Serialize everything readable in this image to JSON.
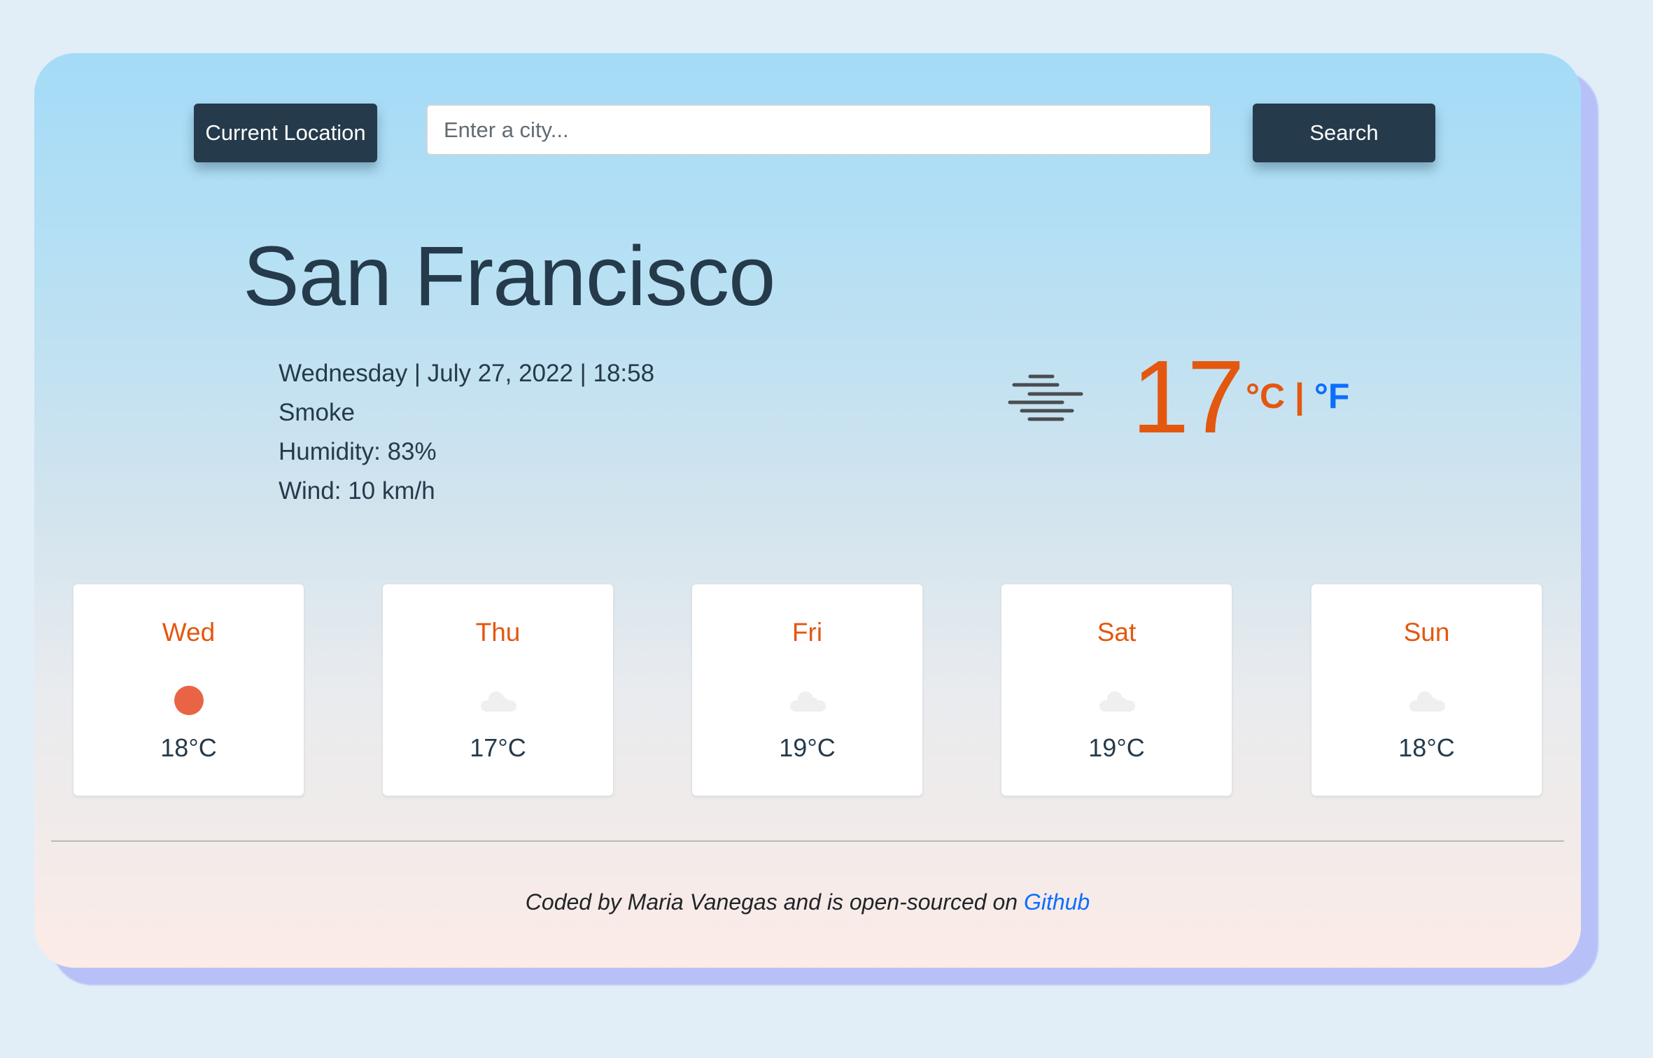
{
  "search": {
    "current_location_label": "Current Location",
    "city_placeholder": "Enter a city...",
    "city_value": "",
    "search_label": "Search"
  },
  "current": {
    "city": "San Francisco",
    "datetime": "Wednesday | July 27, 2022 | 18:58",
    "description": "Smoke",
    "humidity": "Humidity: 83%",
    "wind": "Wind: 10 km/h",
    "icon": "haze-icon",
    "temperature": "17",
    "unit_celsius": "°C",
    "unit_separator": "|",
    "unit_fahrenheit": "°F"
  },
  "forecast": [
    {
      "day": "Wed",
      "icon": "sun-icon",
      "temp": "18°C"
    },
    {
      "day": "Thu",
      "icon": "cloud-icon",
      "temp": "17°C"
    },
    {
      "day": "Fri",
      "icon": "cloud-icon",
      "temp": "19°C"
    },
    {
      "day": "Sat",
      "icon": "cloud-icon",
      "temp": "19°C"
    },
    {
      "day": "Sun",
      "icon": "cloud-icon",
      "temp": "18°C"
    }
  ],
  "footer": {
    "text": "Coded by Maria Vanegas and is open-sourced on ",
    "link_label": "Github"
  },
  "colors": {
    "accent_orange": "#e4570f",
    "link_blue": "#0d6efd",
    "dark_navy": "#253a4b",
    "sun": "#e96444",
    "cloud": "#efefef"
  }
}
